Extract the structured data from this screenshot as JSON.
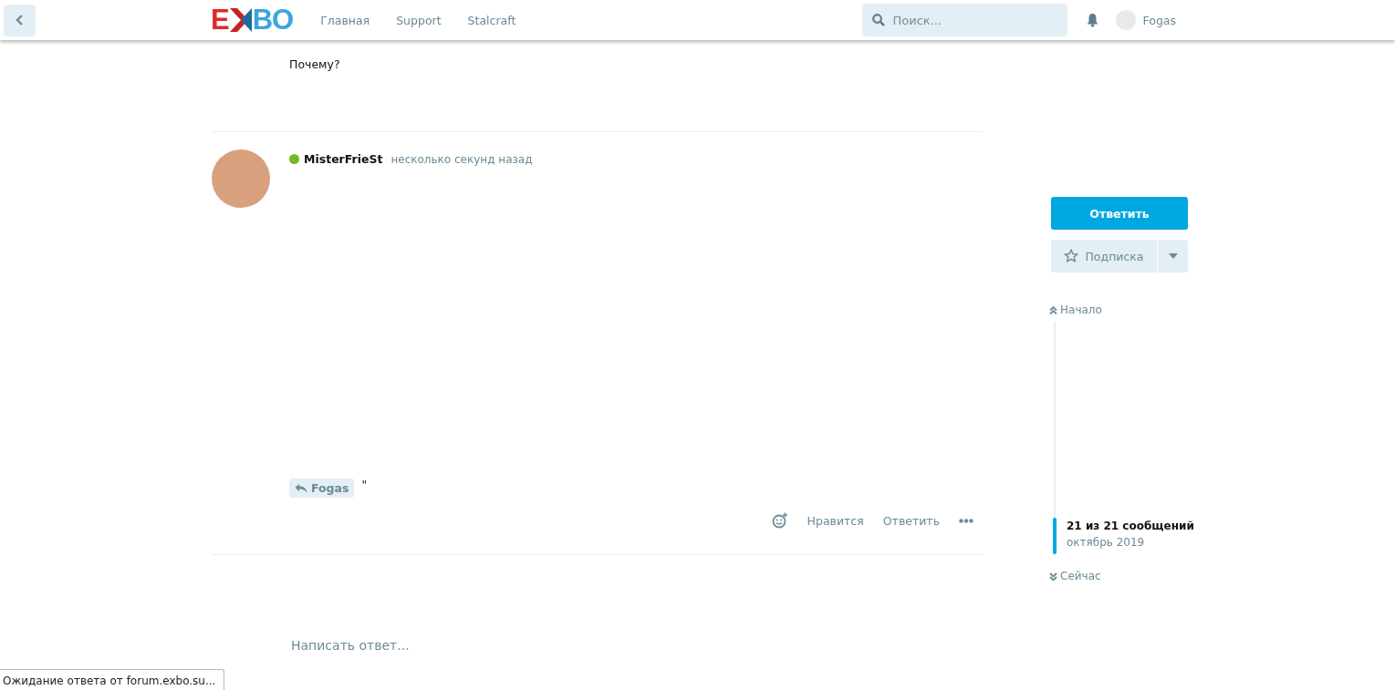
{
  "header": {
    "logo": {
      "left": "E",
      "right": "BO"
    },
    "nav": [
      "Главная",
      "Support",
      "Stalcraft"
    ],
    "search": {
      "placeholder": "Поиск..."
    },
    "user": "Fogas"
  },
  "prev_post": {
    "body": "Почему?"
  },
  "post": {
    "author": "MisterFrieSt",
    "online": true,
    "time": "несколько секунд назад",
    "mention": "Fogas",
    "body": "\"",
    "actions": [
      "Нравится",
      "Ответить"
    ]
  },
  "composer": {
    "placeholder": "Написать ответ..."
  },
  "sidebar": {
    "reply_button": "Ответить",
    "subscribe_button": "Подписка",
    "scrubber": {
      "top": "Начало",
      "position": "21 из 21 сообщений",
      "date": "октябрь 2019",
      "bottom": "Сейчас",
      "level": 1
    }
  },
  "browser_status": "Ожидание ответа от forum.exbo.su..."
}
